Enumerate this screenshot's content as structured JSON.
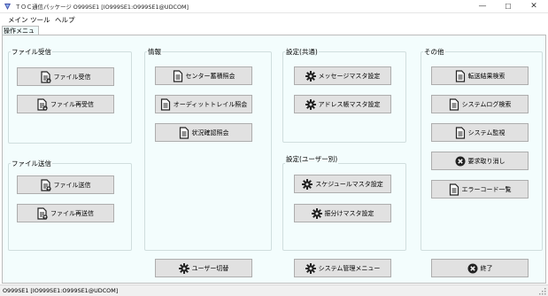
{
  "window": {
    "title": "ＴＯＣ通信パッケージ O999SE1 [IO999SE1:O999SE1@UDCOM]",
    "controls": {
      "minimize": "—",
      "maximize": "☐",
      "close": "✕"
    }
  },
  "menubar": {
    "items": [
      "メイン",
      "ツール",
      "ヘルプ"
    ]
  },
  "tab": {
    "label": "操作メニュー"
  },
  "groups": {
    "file_receive": {
      "title": "ファイル受信",
      "buttons": [
        {
          "label": "ファイル受信",
          "icon": "file-receive-icon"
        },
        {
          "label": "ファイル再受信",
          "icon": "file-receive-icon"
        }
      ]
    },
    "file_send": {
      "title": "ファイル送信",
      "buttons": [
        {
          "label": "ファイル送信",
          "icon": "file-send-icon"
        },
        {
          "label": "ファイル再送信",
          "icon": "file-send-icon"
        }
      ]
    },
    "info": {
      "title": "情報",
      "buttons": [
        {
          "label": "センター蓄積照会",
          "icon": "document-icon"
        },
        {
          "label": "オーディットトレイル照会",
          "icon": "document-icon"
        },
        {
          "label": "状況確認照会",
          "icon": "document-icon"
        }
      ]
    },
    "settings_common": {
      "title": "設定(共通)",
      "buttons": [
        {
          "label": "メッセージマスタ設定",
          "icon": "gear-icon"
        },
        {
          "label": "アドレス帳マスタ設定",
          "icon": "gear-icon"
        }
      ]
    },
    "settings_user": {
      "title": "設定(ユーザー別)",
      "buttons": [
        {
          "label": "スケジュールマスタ設定",
          "icon": "gear-icon"
        },
        {
          "label": "振分けマスタ設定",
          "icon": "gear-icon"
        }
      ]
    },
    "other": {
      "title": "その他",
      "buttons": [
        {
          "label": "転送結果検索",
          "icon": "document-icon"
        },
        {
          "label": "システムログ検索",
          "icon": "document-icon"
        },
        {
          "label": "システム監視",
          "icon": "document-icon"
        },
        {
          "label": "要求取り消し",
          "icon": "cancel-icon"
        },
        {
          "label": "エラーコード一覧",
          "icon": "document-icon"
        }
      ]
    }
  },
  "bottom_buttons": {
    "user_switch": {
      "label": "ユーザー切替",
      "icon": "gear-icon"
    },
    "system_admin": {
      "label": "システム管理メニュー",
      "icon": "gear-icon"
    },
    "exit": {
      "label": "終了",
      "icon": "cancel-icon"
    }
  },
  "statusbar": {
    "text": "O999SE1 [IO999SE1:O999SE1@UDCOM]"
  },
  "colors": {
    "content_bg": "#f3fdfd",
    "button_face": "#e1e1e1",
    "button_border": "#adadad",
    "title_icon": "#3c4aa8"
  }
}
